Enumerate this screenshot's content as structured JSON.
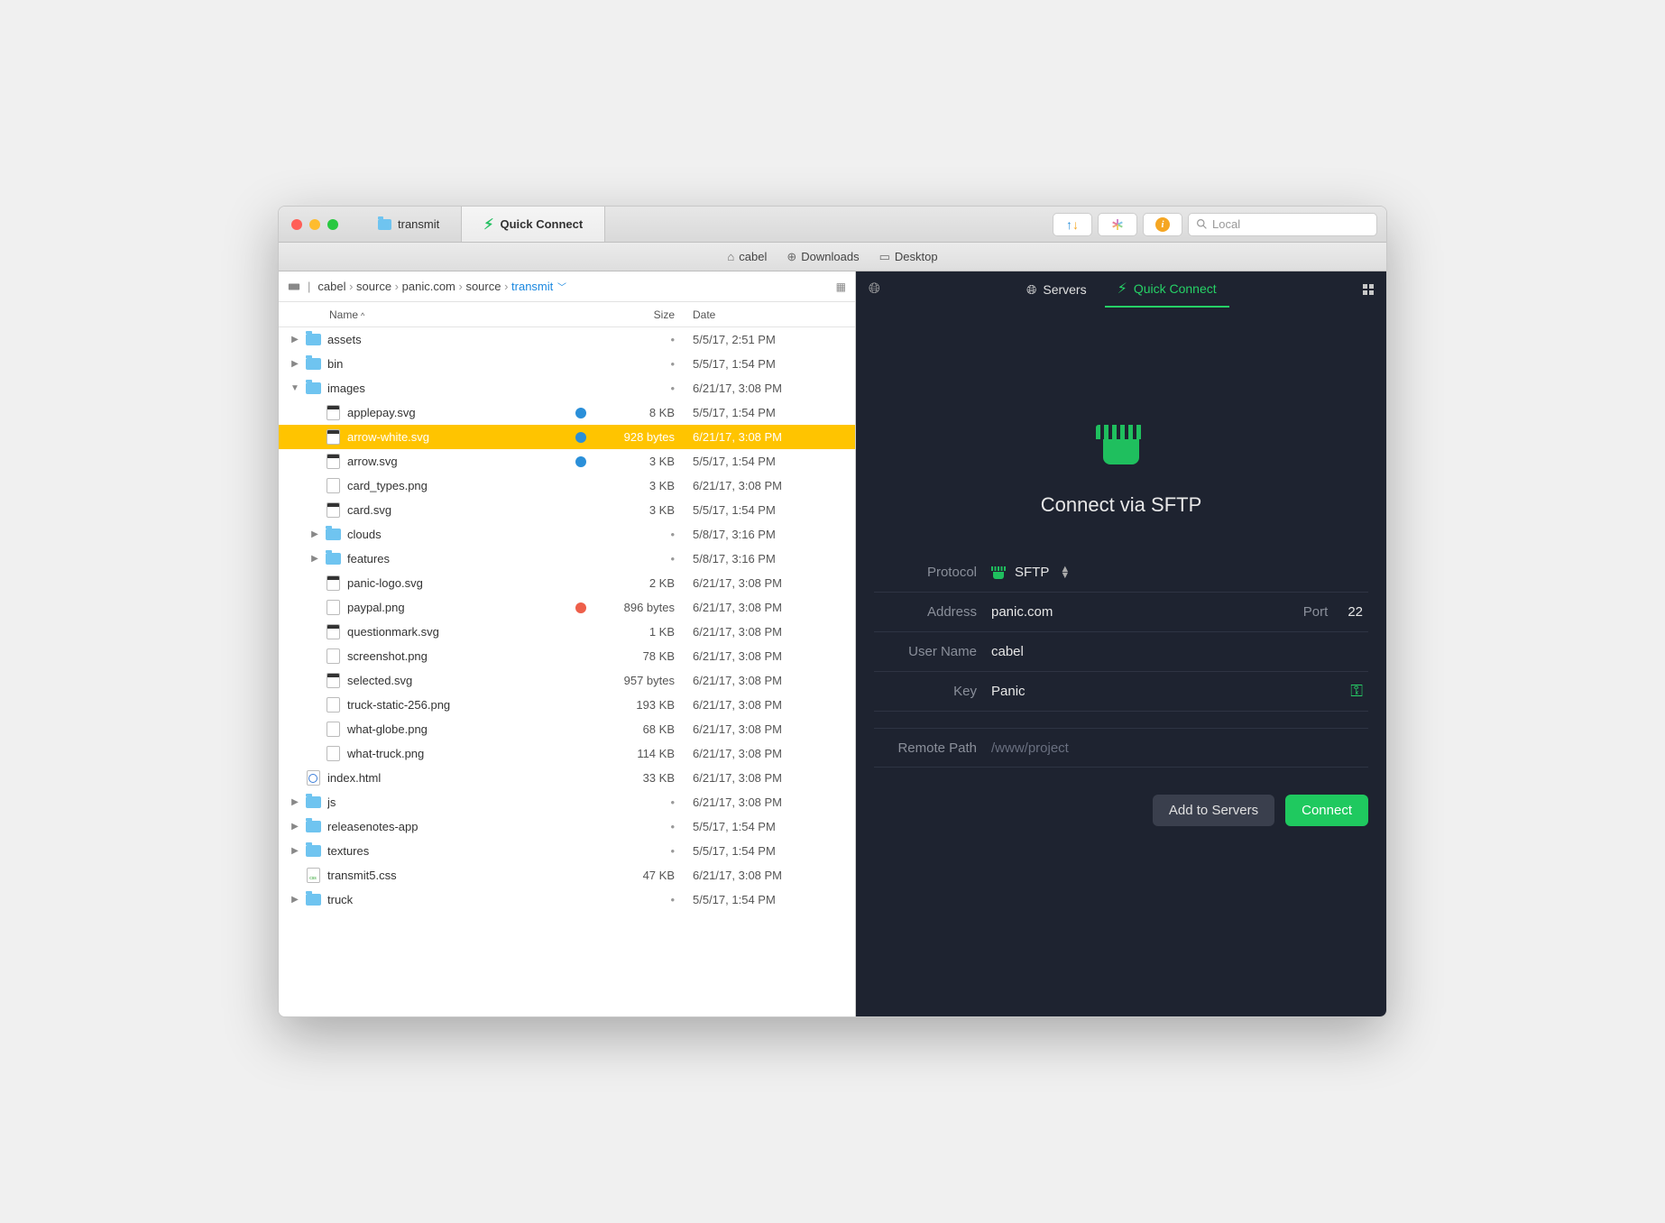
{
  "tabs": {
    "transmit": "transmit",
    "quick": "Quick Connect"
  },
  "search_placeholder": "Local",
  "favorites": {
    "cabel": "cabel",
    "downloads": "Downloads",
    "desktop": "Desktop"
  },
  "path": [
    "cabel",
    "source",
    "panic.com",
    "source",
    "transmit"
  ],
  "columns": {
    "name": "Name",
    "size": "Size",
    "date": "Date"
  },
  "files": [
    {
      "indent": 0,
      "expanded": false,
      "type": "folder",
      "name": "assets",
      "size": "",
      "date": "5/5/17, 2:51 PM"
    },
    {
      "indent": 0,
      "expanded": false,
      "type": "folder",
      "name": "bin",
      "size": "",
      "date": "5/5/17, 1:54 PM"
    },
    {
      "indent": 0,
      "expanded": true,
      "type": "folder",
      "name": "images",
      "size": "",
      "date": "6/21/17, 3:08 PM"
    },
    {
      "indent": 1,
      "type": "svg",
      "name": "applepay.svg",
      "size": "8 KB",
      "date": "5/5/17, 1:54 PM",
      "tag": "#2a8fd9"
    },
    {
      "indent": 1,
      "type": "svg",
      "name": "arrow-white.svg",
      "size": "928 bytes",
      "date": "6/21/17, 3:08 PM",
      "tag": "#2a8fd9",
      "selected": true
    },
    {
      "indent": 1,
      "type": "svg",
      "name": "arrow.svg",
      "size": "3 KB",
      "date": "5/5/17, 1:54 PM",
      "tag": "#2a8fd9"
    },
    {
      "indent": 1,
      "type": "png",
      "name": "card_types.png",
      "size": "3 KB",
      "date": "6/21/17, 3:08 PM"
    },
    {
      "indent": 1,
      "type": "svg",
      "name": "card.svg",
      "size": "3 KB",
      "date": "5/5/17, 1:54 PM"
    },
    {
      "indent": 1,
      "expanded": false,
      "type": "folder",
      "name": "clouds",
      "size": "",
      "date": "5/8/17, 3:16 PM"
    },
    {
      "indent": 1,
      "expanded": false,
      "type": "folder",
      "name": "features",
      "size": "",
      "date": "5/8/17, 3:16 PM"
    },
    {
      "indent": 1,
      "type": "svg",
      "name": "panic-logo.svg",
      "size": "2 KB",
      "date": "6/21/17, 3:08 PM"
    },
    {
      "indent": 1,
      "type": "png",
      "name": "paypal.png",
      "size": "896 bytes",
      "date": "6/21/17, 3:08 PM",
      "tag": "#ee5f4a"
    },
    {
      "indent": 1,
      "type": "svg",
      "name": "questionmark.svg",
      "size": "1 KB",
      "date": "6/21/17, 3:08 PM"
    },
    {
      "indent": 1,
      "type": "png",
      "name": "screenshot.png",
      "size": "78 KB",
      "date": "6/21/17, 3:08 PM"
    },
    {
      "indent": 1,
      "type": "svg",
      "name": "selected.svg",
      "size": "957 bytes",
      "date": "6/21/17, 3:08 PM"
    },
    {
      "indent": 1,
      "type": "png",
      "name": "truck-static-256.png",
      "size": "193 KB",
      "date": "6/21/17, 3:08 PM"
    },
    {
      "indent": 1,
      "type": "png",
      "name": "what-globe.png",
      "size": "68 KB",
      "date": "6/21/17, 3:08 PM"
    },
    {
      "indent": 1,
      "type": "png",
      "name": "what-truck.png",
      "size": "114 KB",
      "date": "6/21/17, 3:08 PM"
    },
    {
      "indent": 0,
      "type": "html",
      "name": "index.html",
      "size": "33 KB",
      "date": "6/21/17, 3:08 PM"
    },
    {
      "indent": 0,
      "expanded": false,
      "type": "folder",
      "name": "js",
      "size": "",
      "date": "6/21/17, 3:08 PM"
    },
    {
      "indent": 0,
      "expanded": false,
      "type": "folder",
      "name": "releasenotes-app",
      "size": "",
      "date": "5/5/17, 1:54 PM"
    },
    {
      "indent": 0,
      "expanded": false,
      "type": "folder",
      "name": "textures",
      "size": "",
      "date": "5/5/17, 1:54 PM"
    },
    {
      "indent": 0,
      "type": "css",
      "name": "transmit5.css",
      "size": "47 KB",
      "date": "6/21/17, 3:08 PM"
    },
    {
      "indent": 0,
      "expanded": false,
      "type": "folder",
      "name": "truck",
      "size": "",
      "date": "5/5/17, 1:54 PM"
    }
  ],
  "right": {
    "tabs": {
      "servers": "Servers",
      "quick": "Quick Connect"
    },
    "title": "Connect via SFTP",
    "labels": {
      "protocol": "Protocol",
      "address": "Address",
      "port": "Port",
      "user": "User Name",
      "key": "Key",
      "remote": "Remote Path"
    },
    "values": {
      "protocol": "SFTP",
      "address": "panic.com",
      "port": "22",
      "user": "cabel",
      "key": "Panic",
      "remote": "/www/project"
    },
    "buttons": {
      "add": "Add to Servers",
      "connect": "Connect"
    }
  }
}
